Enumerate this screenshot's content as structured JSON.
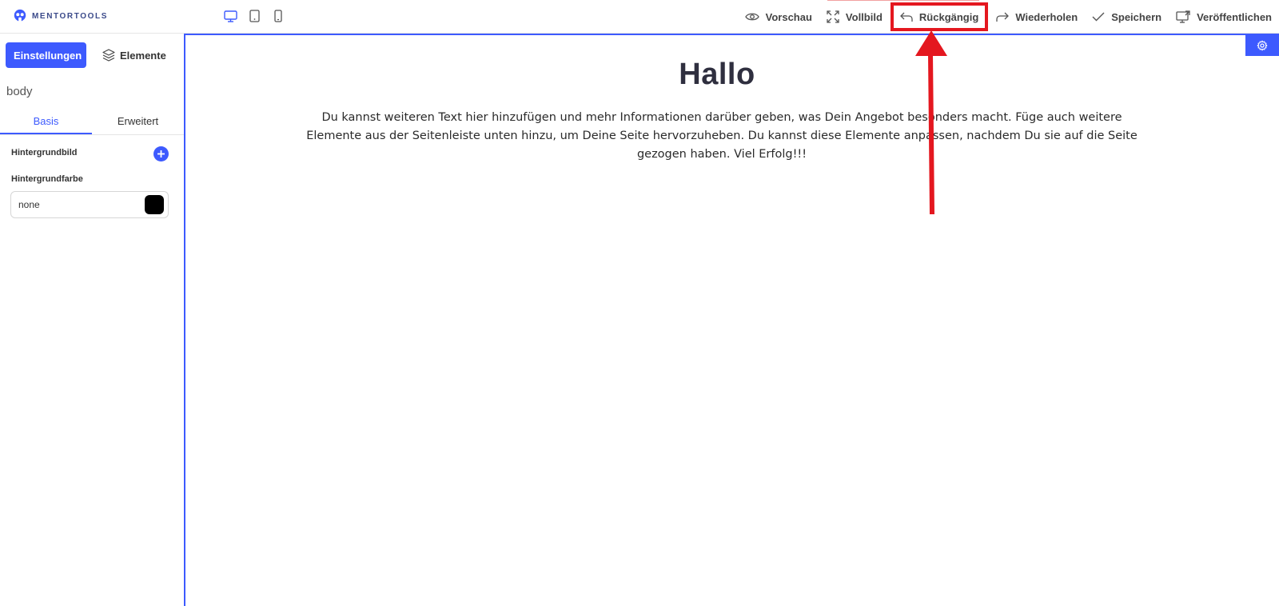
{
  "brand": {
    "name": "MENTORTOOLS",
    "accent": "#3d5afe"
  },
  "devices": [
    {
      "name": "desktop-icon",
      "active": true
    },
    {
      "name": "tablet-icon",
      "active": false
    },
    {
      "name": "mobile-icon",
      "active": false
    }
  ],
  "toolbar": {
    "preview": "Vorschau",
    "fullscreen": "Vollbild",
    "undo": "Rückgängig",
    "redo": "Wiederholen",
    "save": "Speichern",
    "publish": "Veröffentlichen"
  },
  "sidebar": {
    "tabs": {
      "settings": "Einstellungen",
      "elements": "Elemente"
    },
    "selected_element": "body",
    "subtabs": {
      "basic": "Basis",
      "advanced": "Erweitert"
    },
    "fields": {
      "background_image_label": "Hintergrundbild",
      "background_color_label": "Hintergrundfarbe",
      "background_color_value": "none",
      "swatch_color": "#000000"
    }
  },
  "canvas": {
    "headline": "Hallo",
    "paragraph": "Du kannst weiteren Text hier hinzufügen und mehr Informationen darüber geben, was Dein Angebot besonders macht. Füge auch weitere Elemente aus der Seitenleiste unten hinzu, um Deine Seite hervorzuheben. Du kannst diese Elemente anpassen, nachdem Du sie auf die Seite gezogen haben. Viel Erfolg!!!"
  },
  "annotation": {
    "highlight_color": "#e4171f",
    "target": "undo"
  }
}
